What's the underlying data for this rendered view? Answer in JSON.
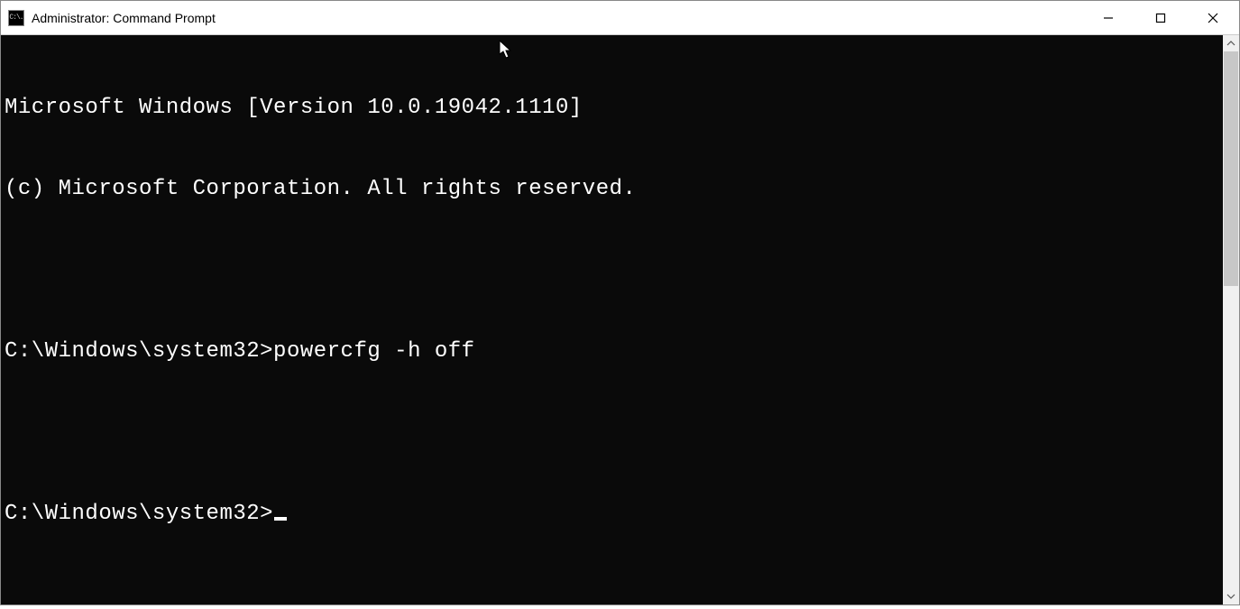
{
  "window": {
    "title": "Administrator: Command Prompt",
    "icon_label": "C:\\."
  },
  "terminal": {
    "lines": [
      "Microsoft Windows [Version 10.0.19042.1110]",
      "(c) Microsoft Corporation. All rights reserved.",
      "",
      "C:\\Windows\\system32>powercfg -h off",
      "",
      "C:\\Windows\\system32>"
    ]
  }
}
